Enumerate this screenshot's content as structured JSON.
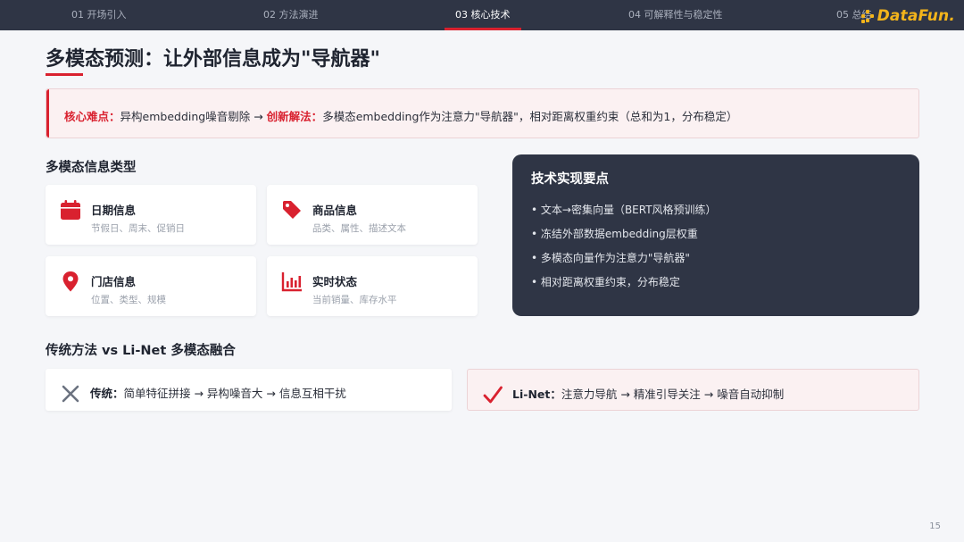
{
  "nav": {
    "items": [
      {
        "label": "01 开场引入",
        "active": false
      },
      {
        "label": "02 方法演进",
        "active": false
      },
      {
        "label": "03 核心技术",
        "active": true
      },
      {
        "label": "04 可解释性与稳定性",
        "active": false
      },
      {
        "label": "05 总结",
        "active": false
      }
    ],
    "logo_text": "DataFun."
  },
  "page": {
    "title": "多模态预测：让外部信息成为\"导航器\"",
    "page_number": "15"
  },
  "banner": {
    "difficulty_label": "核心难点：",
    "difficulty_text": "异构embedding噪音剔除",
    "arrow": "→",
    "solution_label": "创新解法：",
    "solution_text": "多模态embedding作为注意力\"导航器\"，相对距离权重约束（总和为1，分布稳定）"
  },
  "info_types": {
    "heading": "多模态信息类型",
    "cards": [
      {
        "title": "日期信息",
        "desc": "节假日、周末、促销日",
        "icon": "calendar-icon"
      },
      {
        "title": "商品信息",
        "desc": "品类、属性、描述文本",
        "icon": "tag-icon"
      },
      {
        "title": "门店信息",
        "desc": "位置、类型、规模",
        "icon": "map-pin-icon"
      },
      {
        "title": "实时状态",
        "desc": "当前销量、库存水平",
        "icon": "bar-chart-icon"
      }
    ]
  },
  "tech": {
    "title": "技术实现要点",
    "items": [
      "• 文本→密集向量（BERT风格预训练）",
      "• 冻结外部数据embedding层权重",
      "• 多模态向量作为注意力\"导航器\"",
      "• 相对距离权重约束，分布稳定"
    ]
  },
  "comparison": {
    "heading": "传统方法 vs Li-Net 多模态融合",
    "traditional": {
      "label": "传统：",
      "text": "简单特征拼接 → 异构噪音大 → 信息互相干扰",
      "icon": "close-icon"
    },
    "linet": {
      "label": "Li-Net：",
      "text": "注意力导航 → 精准引导关注 → 噪音自动抑制",
      "icon": "check-icon"
    }
  },
  "colors": {
    "accent": "#d9212f",
    "nav_bg": "#2f3545",
    "logo": "#f3b41b"
  }
}
